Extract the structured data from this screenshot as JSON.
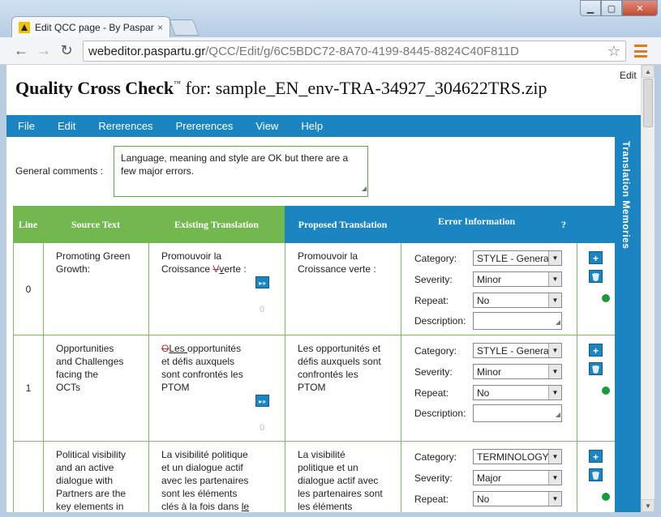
{
  "browser": {
    "tab_title": "Edit QCC page - By Paspartu",
    "tab_close": "×",
    "url_host": "webeditor.paspartu.gr",
    "url_path": "/QCC/Edit/g/6C5BDC72-8A70-4199-8445-8824C40F811D"
  },
  "page": {
    "edit_link": "Edit",
    "title_bold": "Quality Cross Check",
    "title_tm": "™",
    "title_rest": " for: sample_EN_env-TRA-34927_304622TRS.zip"
  },
  "menu": {
    "file": "File",
    "edit": "Edit",
    "references": "Rererences",
    "preferences": "Prererences",
    "view": "View",
    "help": "Help"
  },
  "side_panel": {
    "label": "Translation Memories"
  },
  "general_comments": {
    "label": "General comments :",
    "value": "Language, meaning and style are OK but there are a few major errors."
  },
  "table": {
    "headers": {
      "line": "Line",
      "source": "Source Text",
      "existing": "Existing Translation",
      "proposed": "Proposed Translation",
      "error_info": "Error Information",
      "help": "?"
    },
    "field_labels": {
      "category": "Category:",
      "severity": "Severity:",
      "repeat": "Repeat:",
      "description": "Description:"
    },
    "copy_label": "▸»",
    "add_label": "+",
    "delete_label": "🗑",
    "rows": [
      {
        "line": "0",
        "source": "Promoting Green Growth:",
        "existing_a": "Promouvoir la Croissance ",
        "existing_del": "V",
        "existing_ins": "v",
        "existing_b": "erte :",
        "counter": "0",
        "proposed": "Promouvoir la Croissance verte :",
        "category": "STYLE - General",
        "severity": "Minor",
        "repeat": "No"
      },
      {
        "line": "1",
        "source": "Opportunities and Challenges facing the OCTs",
        "existing_del": "O",
        "existing_ins": "Les ",
        "existing_b": "opportunités et défis auxquels sont confrontés les PTOM",
        "counter": "0",
        "proposed": "Les opportunités et défis auxquels sont confrontés les PTOM",
        "category": "STYLE - General",
        "severity": "Minor",
        "repeat": "No"
      },
      {
        "line": "",
        "source": "Political visibility and an active dialogue with Partners are the key elements in",
        "existing_a": "La visibilité politique et un dialogue actif avec les partenaires sont les éléments clés à la fois dans ",
        "existing_ins": "le",
        "proposed": "La visibilité politique et un dialogue actif avec les partenaires sont les éléments",
        "category": "TERMINOLOGY",
        "severity": "Major",
        "repeat": "No"
      }
    ]
  },
  "colors": {
    "accent_blue": "#1b85c2",
    "accent_green": "#72b84f",
    "status_dot": "#1a9a3a"
  }
}
